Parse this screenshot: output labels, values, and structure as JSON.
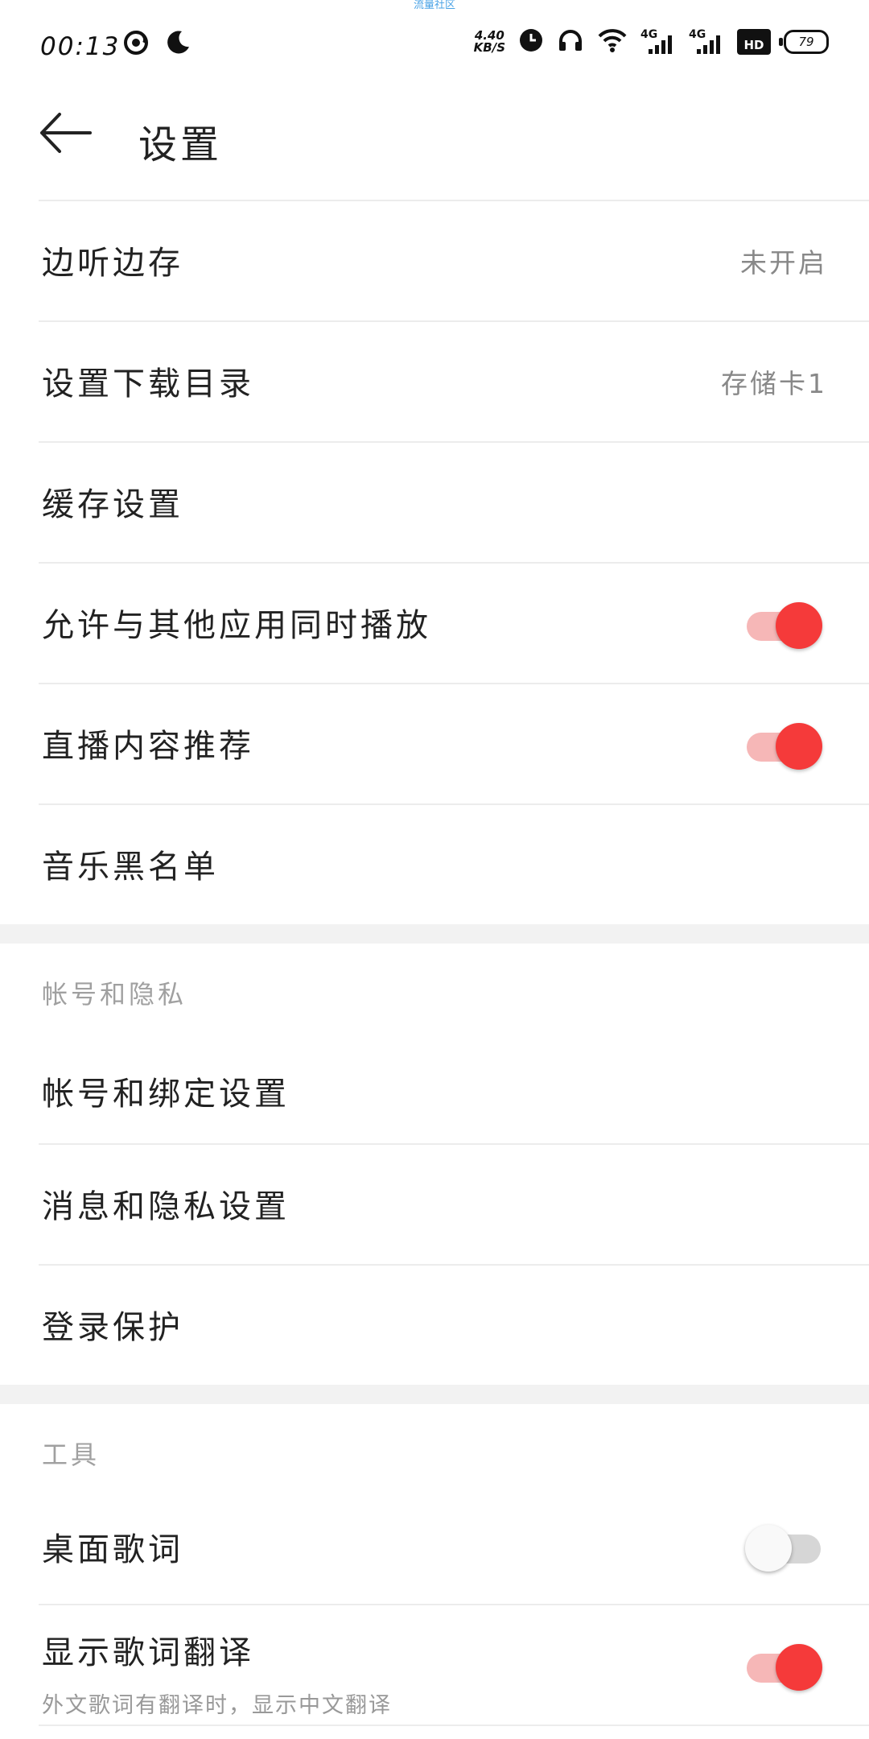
{
  "status_bar": {
    "watermark": "流量社区",
    "time": "00:13",
    "net_speed_value": "4.40",
    "net_speed_unit": "KB/S",
    "signal_1": "4G",
    "signal_2": "4G",
    "hd_label": "HD",
    "battery_level": "79",
    "left_icons": [
      "notification-swirl-icon",
      "moon-icon"
    ],
    "right_icons": [
      "clock-icon",
      "headphones-icon",
      "wifi-icon",
      "signal-icon",
      "signal-icon",
      "hd-icon",
      "battery-icon"
    ]
  },
  "header": {
    "title": "设置",
    "back_icon": "back-arrow-icon"
  },
  "general": {
    "items": [
      {
        "label": "边听边存",
        "value": "未开启"
      },
      {
        "label": "设置下载目录",
        "value": "存储卡1"
      },
      {
        "label": "缓存设置"
      },
      {
        "label": "允许与其他应用同时播放",
        "toggle": true
      },
      {
        "label": "直播内容推荐",
        "toggle": true
      },
      {
        "label": "音乐黑名单"
      }
    ]
  },
  "account_section": {
    "title": "帐号和隐私",
    "items": [
      {
        "label": "帐号和绑定设置"
      },
      {
        "label": "消息和隐私设置"
      },
      {
        "label": "登录保护"
      }
    ]
  },
  "tools_section": {
    "title": "工具",
    "items": [
      {
        "label": "桌面歌词",
        "toggle": false
      },
      {
        "label": "显示歌词翻译",
        "sublabel": "外文歌词有翻译时，显示中文翻译",
        "toggle": true
      }
    ]
  },
  "colors": {
    "accent": "#f53a3a",
    "accent_track": "#f6b7b7",
    "off_track": "#d6d6d6",
    "divider": "#ececec",
    "band": "#f2f2f2"
  }
}
